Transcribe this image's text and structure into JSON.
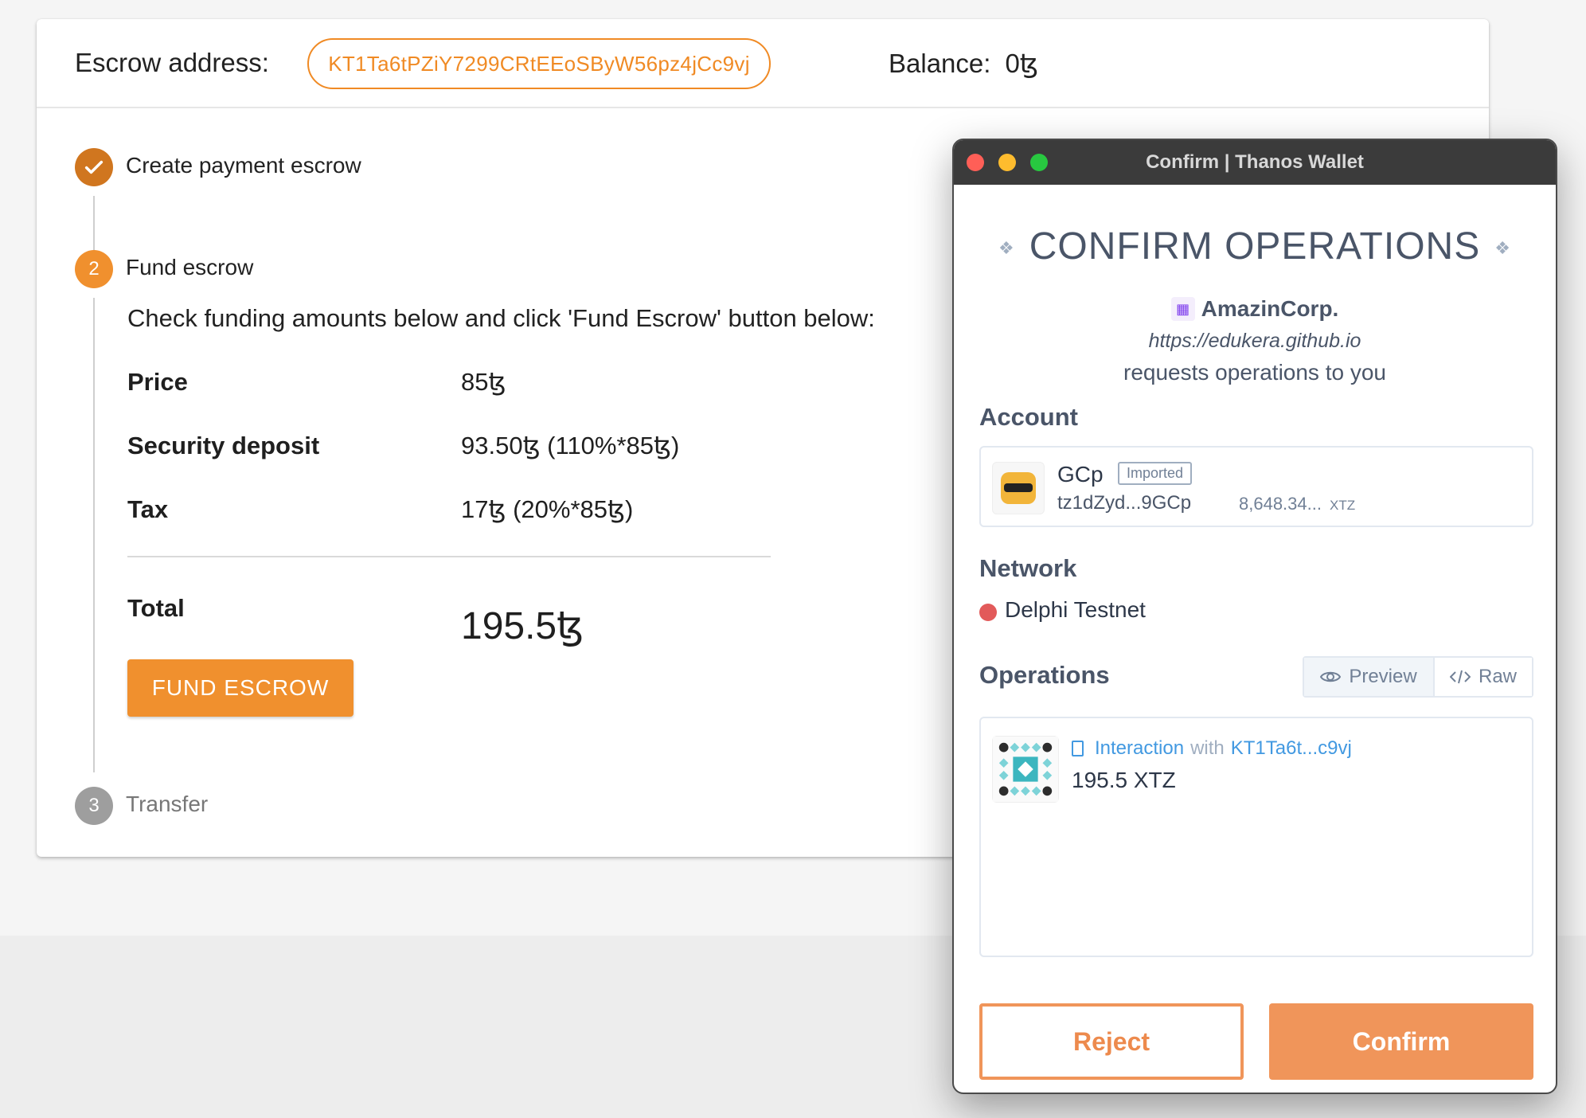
{
  "escrow_page": {
    "header": {
      "escrow_label": "Escrow address:",
      "escrow_address": "KT1Ta6tPZiY7299CRtEEoSByW56pz4jCc9vj",
      "balance_label": "Balance:",
      "balance_value": "0ꜩ"
    },
    "steps": [
      {
        "number": "✓",
        "label": "Create payment escrow",
        "state": "completed"
      },
      {
        "number": "2",
        "label": "Fund escrow",
        "state": "active"
      },
      {
        "number": "3",
        "label": "Transfer",
        "state": "pending"
      }
    ],
    "instructions": "Check funding amounts below and click 'Fund Escrow' button below:",
    "rows": [
      {
        "label": "Price",
        "value": "85ꜩ"
      },
      {
        "label": "Security deposit",
        "value": "93.50ꜩ (110%*85ꜩ)"
      },
      {
        "label": "Tax",
        "value": "17ꜩ (20%*85ꜩ)"
      }
    ],
    "total": {
      "label": "Total",
      "value": "195.5ꜩ"
    },
    "fund_button": "FUND ESCROW",
    "colors": {
      "accent": "#f0902e",
      "step_done": "#d0761f",
      "step_pending": "#9e9e9e"
    }
  },
  "wallet": {
    "window_title": "Confirm | Thanos Wallet",
    "heading": "CONFIRM OPERATIONS",
    "app": {
      "name": "AmazinCorp.",
      "url": "https://edukera.github.io",
      "request_text": "requests operations to you"
    },
    "account": {
      "section_title": "Account",
      "name": "GCp",
      "badge": "Imported",
      "address": "tz1dZyd...9GCp",
      "balance": "8,648.34...",
      "unit": "XTZ"
    },
    "network": {
      "section_title": "Network",
      "name": "Delphi Testnet",
      "color": "#e25a5a"
    },
    "operations": {
      "section_title": "Operations",
      "view_preview": "Preview",
      "view_raw": "Raw",
      "items": [
        {
          "kind": "Interaction",
          "with": "with",
          "target": "KT1Ta6t...c9vj",
          "amount": "195.5 XTZ"
        }
      ]
    },
    "buttons": {
      "reject": "Reject",
      "confirm": "Confirm"
    },
    "colors": {
      "accent": "#f0955a",
      "link": "#4299e1"
    }
  }
}
